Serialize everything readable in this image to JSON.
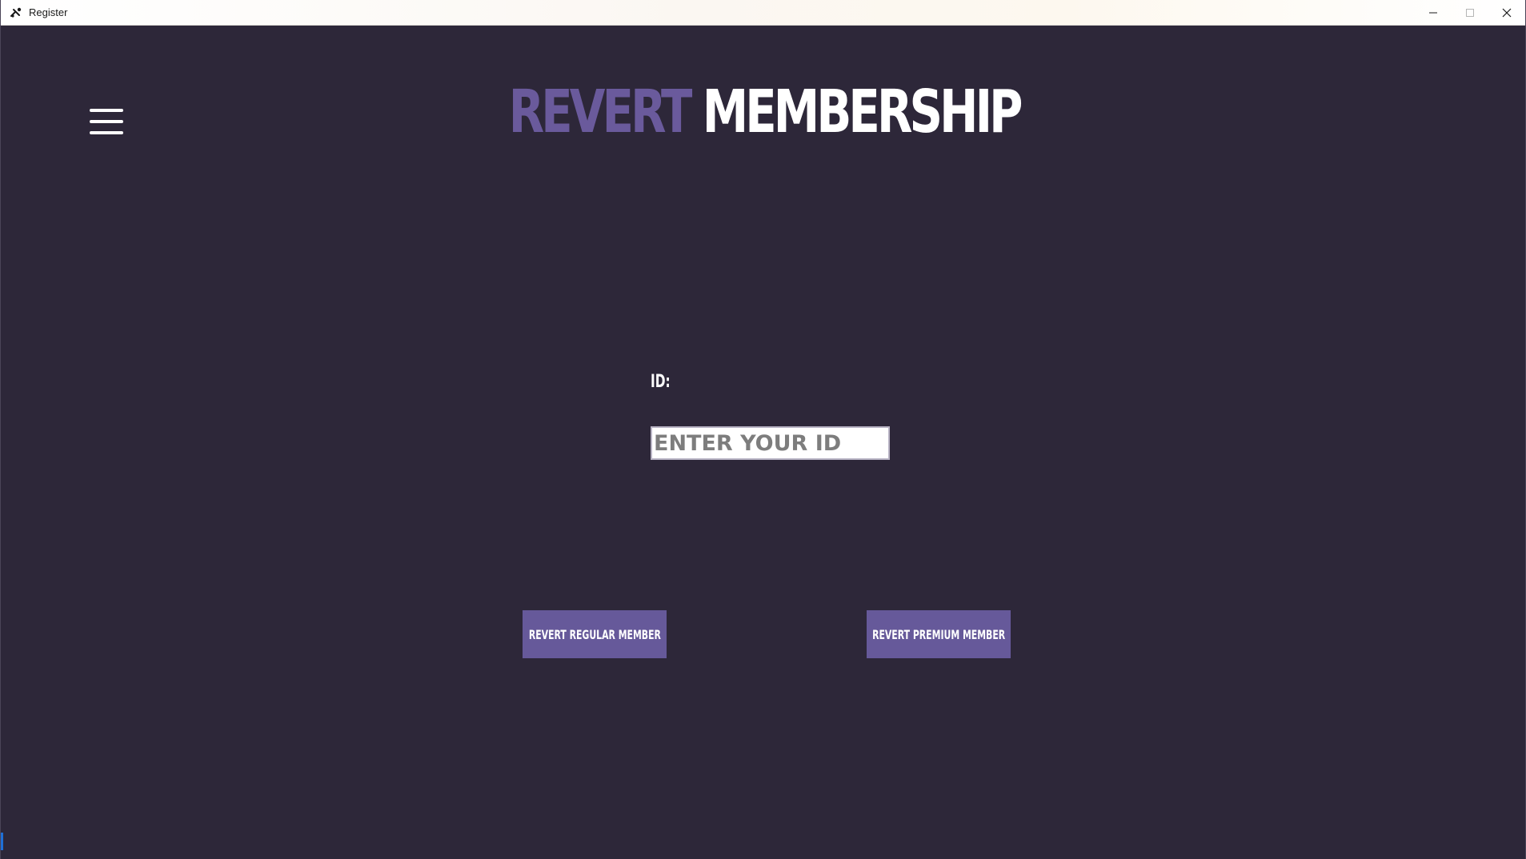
{
  "window": {
    "title": "Register"
  },
  "header": {
    "title_accent": "REVERT",
    "title_main": "MEMBERSHIP"
  },
  "form": {
    "id_label": "ID:",
    "id_placeholder": "ENTER YOUR ID",
    "id_value": ""
  },
  "actions": {
    "regular_label": "REVERT REGULAR MEMBER",
    "premium_label": "REVERT PREMIUM MEMBER"
  },
  "icons": {
    "app": "app-icon",
    "menu": "hamburger-menu-icon",
    "minimize": "minimize-icon",
    "maximize": "maximize-icon",
    "close": "close-icon"
  },
  "colors": {
    "background": "#2d2739",
    "accent": "#6a5a9c",
    "button": "#66599a",
    "text": "#ffffff"
  }
}
